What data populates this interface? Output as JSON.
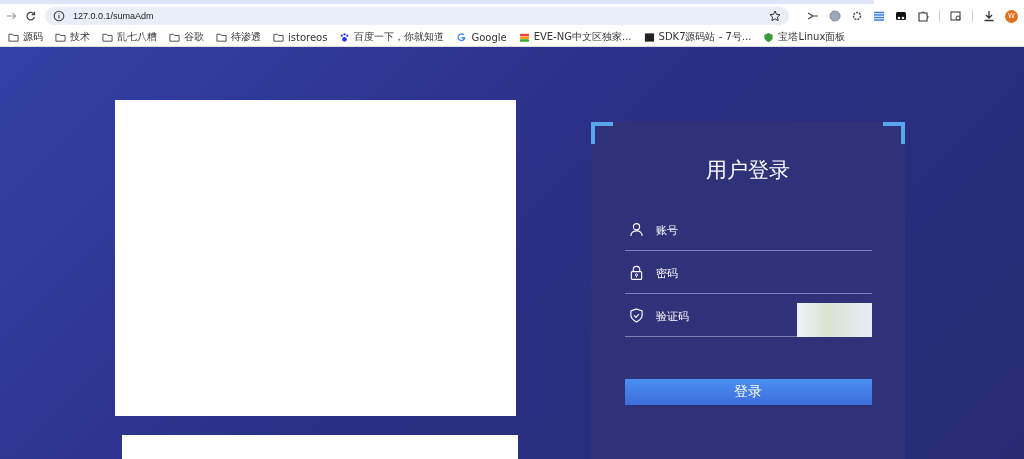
{
  "browser": {
    "address": "127.0.0.1/sumaAdm",
    "avatar": "W",
    "bookmarks": [
      {
        "label": "源码",
        "kind": "folder"
      },
      {
        "label": "技术",
        "kind": "folder"
      },
      {
        "label": "乱七八糟",
        "kind": "folder"
      },
      {
        "label": "谷歌",
        "kind": "folder"
      },
      {
        "label": "待渗透",
        "kind": "folder"
      },
      {
        "label": "istoreos",
        "kind": "folder"
      },
      {
        "label": "百度一下，你就知道",
        "kind": "paw"
      },
      {
        "label": "Google",
        "kind": "google"
      },
      {
        "label": "EVE-NG中文区独家...",
        "kind": "stack"
      },
      {
        "label": "SDK7源码站 - 7号...",
        "kind": "square"
      },
      {
        "label": "宝塔Linux面板",
        "kind": "shield"
      }
    ]
  },
  "login": {
    "title": "用户登录",
    "fields": [
      {
        "kind": "user",
        "placeholder": "账号"
      },
      {
        "kind": "lock",
        "placeholder": "密码"
      },
      {
        "kind": "captcha",
        "placeholder": "验证码"
      }
    ],
    "button": "登录"
  }
}
